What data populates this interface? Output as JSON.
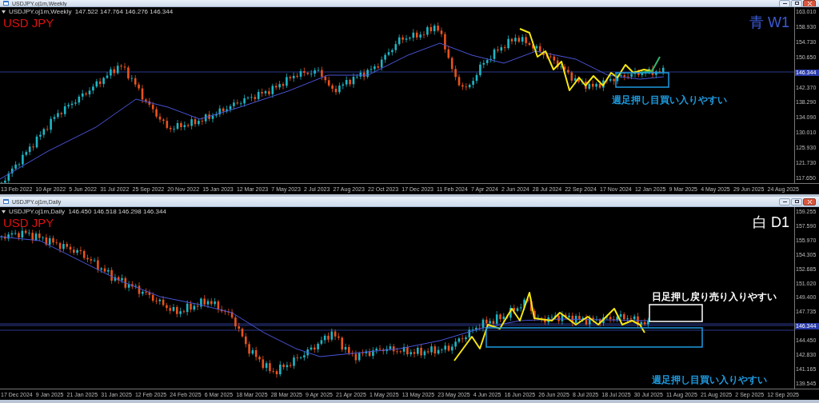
{
  "windows": [
    {
      "title": "USDJPY.oj1m,Weekly",
      "info": "USDJPY.oj1m,Weekly  147.522 147.764 146.276 146.344",
      "symbol": "USD JPY",
      "timeframe_label": "青 W1",
      "annotations": [
        {
          "text": "週足押し目買い入りやすい",
          "color": "#1e9be0"
        }
      ],
      "price_axis": [
        {
          "label": "163.010",
          "kind": "tick"
        },
        {
          "label": "158.930",
          "kind": "tick"
        },
        {
          "label": "154.730",
          "kind": "tick"
        },
        {
          "label": "150.650",
          "kind": "tick"
        },
        {
          "label": "146.344",
          "kind": "current"
        },
        {
          "label": "142.370",
          "kind": "tick"
        },
        {
          "label": "138.290",
          "kind": "tick"
        },
        {
          "label": "134.090",
          "kind": "tick"
        },
        {
          "label": "130.010",
          "kind": "tick"
        },
        {
          "label": "125.930",
          "kind": "tick"
        },
        {
          "label": "121.730",
          "kind": "tick"
        },
        {
          "label": "117.650",
          "kind": "tick"
        }
      ],
      "time_axis": [
        "13 Feb 2022",
        "10 Apr 2022",
        "5 Jun 2022",
        "31 Jul 2022",
        "25 Sep 2022",
        "20 Nov 2022",
        "15 Jan 2023",
        "12 Mar 2023",
        "7 May 2023",
        "2 Jul 2023",
        "27 Aug 2023",
        "22 Oct 2023",
        "17 Dec 2023",
        "11 Feb 2024",
        "7 Apr 2024",
        "2 Jun 2024",
        "28 Jul 2024",
        "22 Sep 2024",
        "17 Nov 2024",
        "12 Jan 2025",
        "9 Mar 2025",
        "4 May 2025",
        "29 Jun 2025",
        "24 Aug 2025"
      ]
    },
    {
      "title": "USDJPY.oj1m,Daily",
      "info": "USDJPY.oj1m,Daily  146.450 146.518 146.298 146.344",
      "symbol": "USD JPY",
      "timeframe_label": "白 D1",
      "annotations": [
        {
          "text": "日足押し戻り売り入りやすい",
          "color": "#ffffff"
        },
        {
          "text": "週足押し目買い入りやすい",
          "color": "#1e9be0"
        }
      ],
      "price_axis": [
        {
          "label": "159.255",
          "kind": "tick"
        },
        {
          "label": "157.590",
          "kind": "tick"
        },
        {
          "label": "155.970",
          "kind": "tick"
        },
        {
          "label": "154.305",
          "kind": "tick"
        },
        {
          "label": "152.685",
          "kind": "tick"
        },
        {
          "label": "151.020",
          "kind": "tick"
        },
        {
          "label": "149.400",
          "kind": "tick"
        },
        {
          "label": "147.735",
          "kind": "tick"
        },
        {
          "label": "146.344",
          "kind": "current"
        },
        {
          "label": "144.450",
          "kind": "tick"
        },
        {
          "label": "142.830",
          "kind": "tick"
        },
        {
          "label": "141.165",
          "kind": "tick"
        },
        {
          "label": "139.545",
          "kind": "tick"
        }
      ],
      "time_axis": [
        "17 Dec 2024",
        "9 Jan 2025",
        "21 Jan 2025",
        "31 Jan 2025",
        "12 Feb 2025",
        "24 Feb 2025",
        "6 Mar 2025",
        "18 Mar 2025",
        "28 Mar 2025",
        "9 Apr 2025",
        "21 Apr 2025",
        "1 May 2025",
        "13 May 2025",
        "23 May 2025",
        "4 Jun 2025",
        "16 Jun 2025",
        "26 Jun 2025",
        "8 Jul 2025",
        "18 Jul 2025",
        "30 Jul 2025",
        "11 Aug 2025",
        "21 Aug 2025",
        "2 Sep 2025",
        "12 Sep 2025"
      ]
    }
  ]
}
